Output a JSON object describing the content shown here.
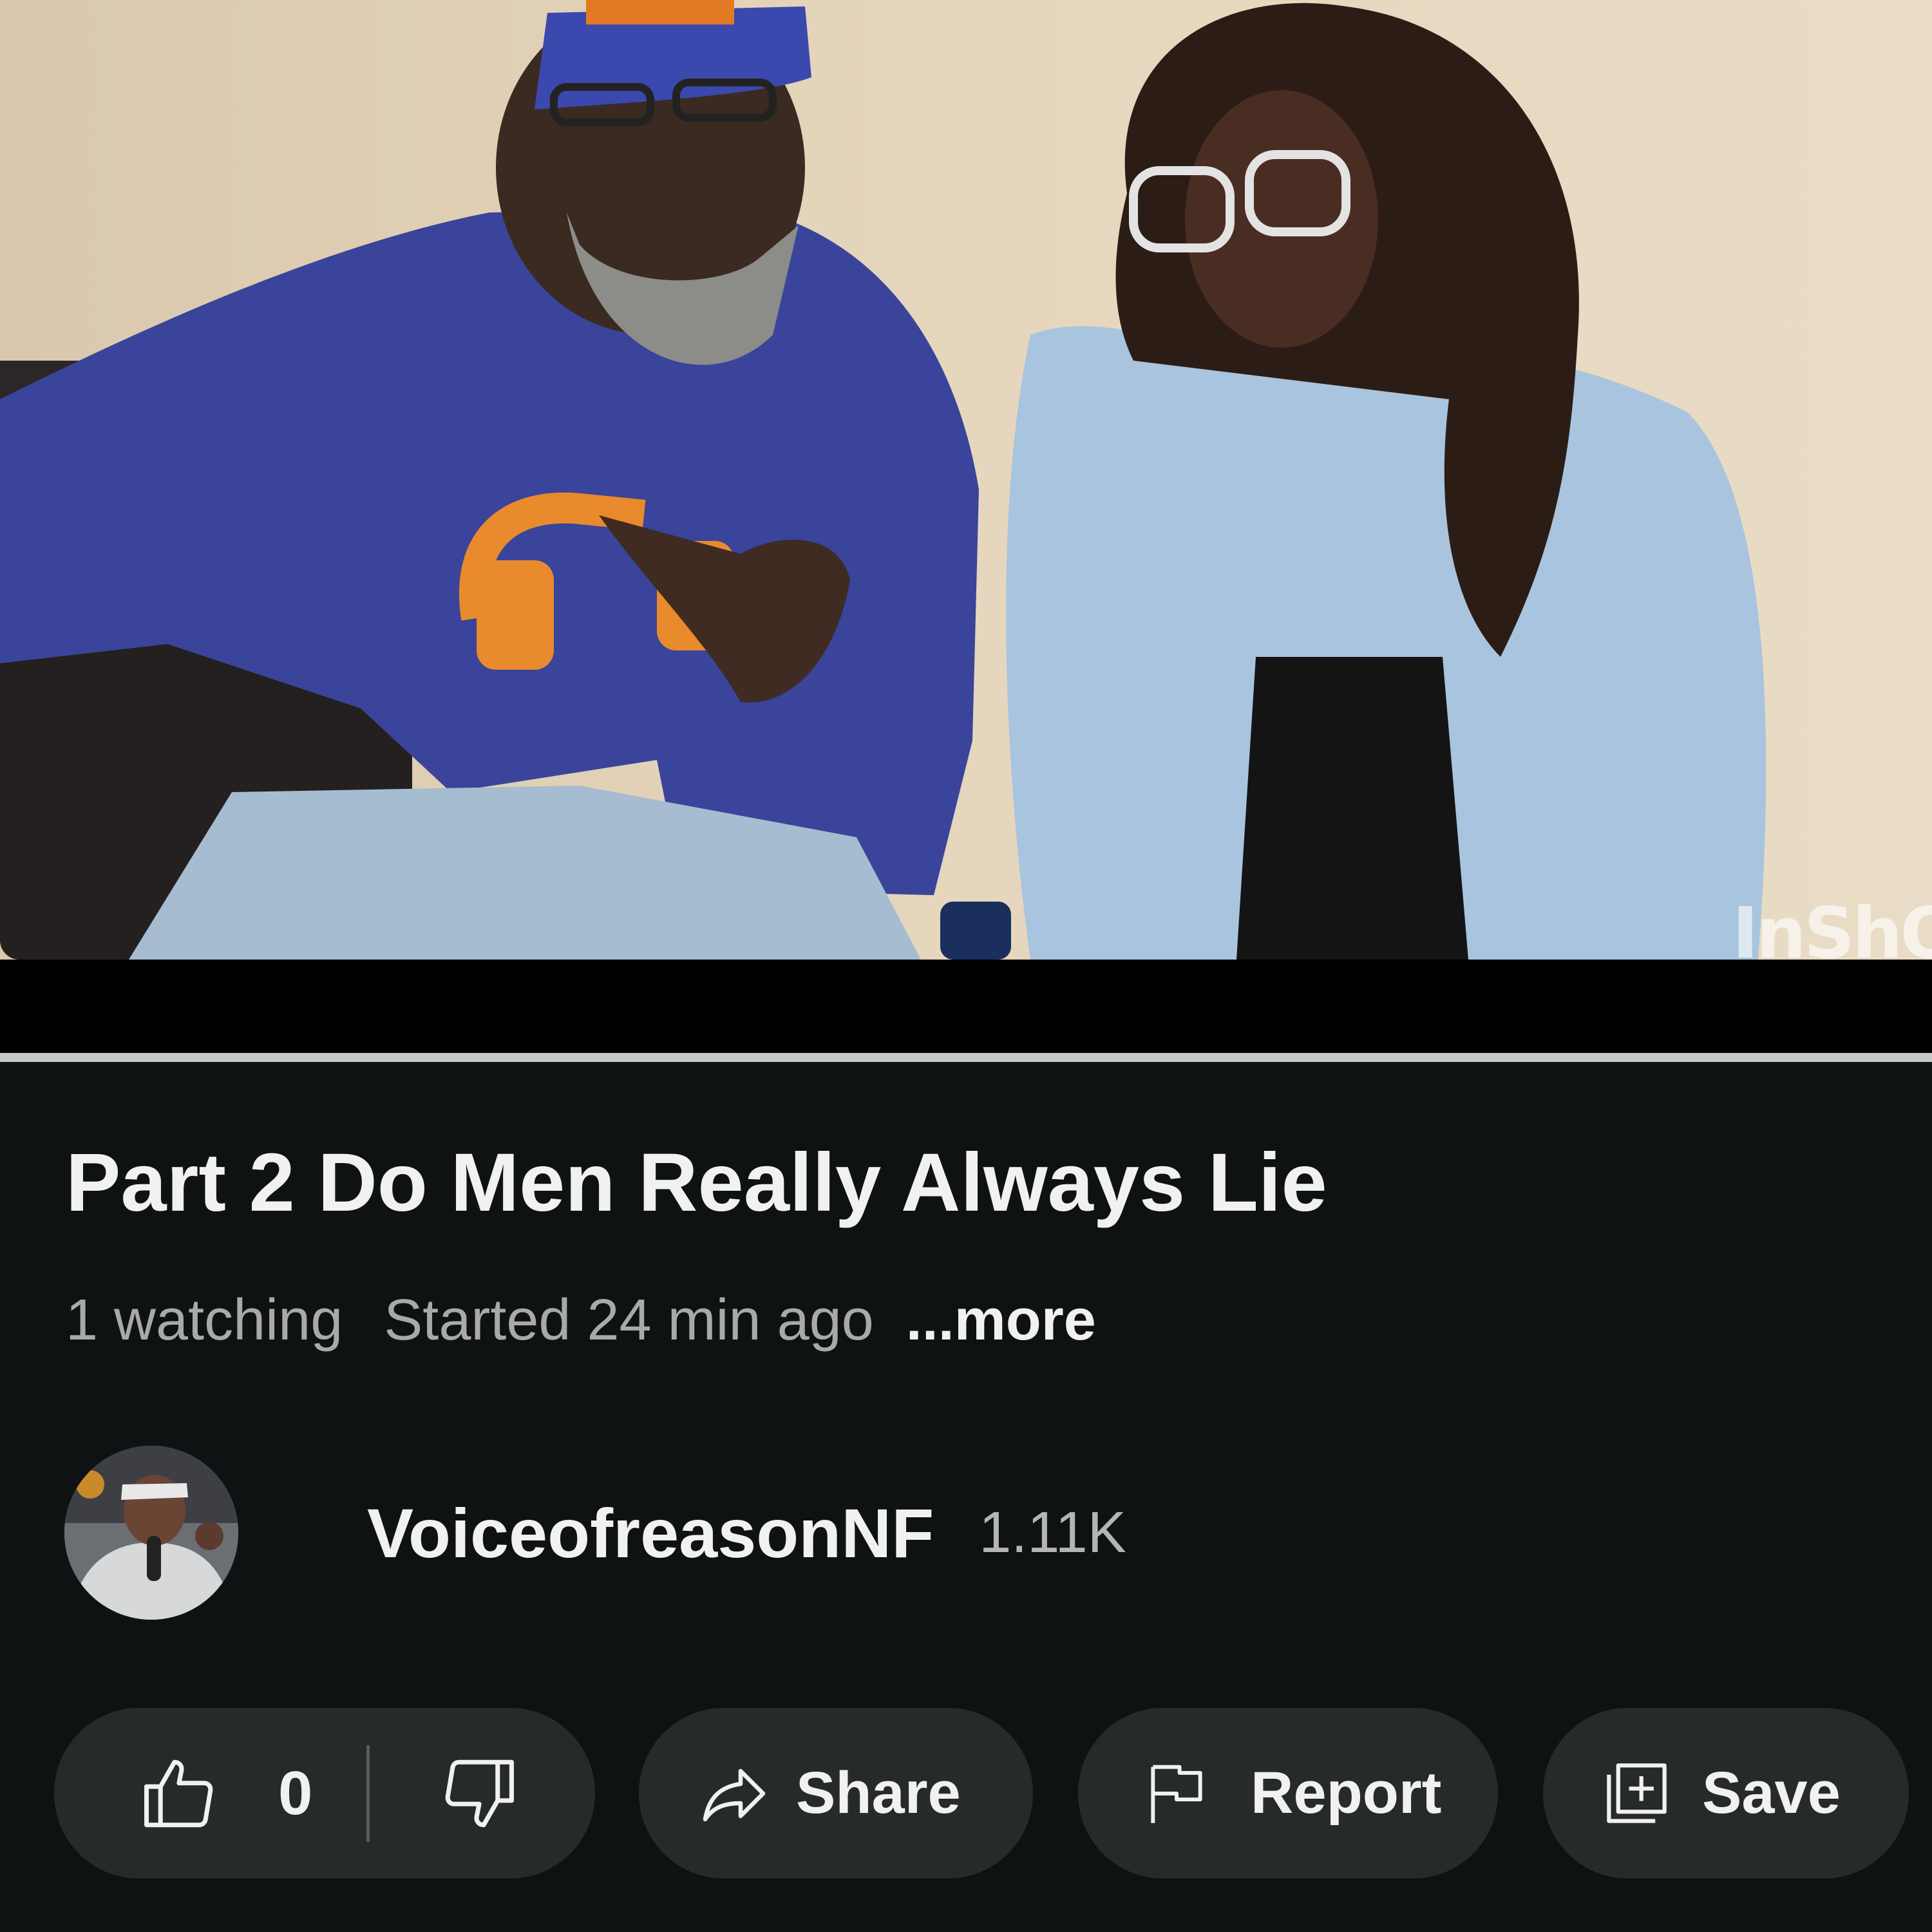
{
  "player": {
    "watermark": "InShO"
  },
  "video": {
    "title": "Part 2 Do Men Really Always Lie",
    "watching": "1 watching",
    "started": "Started 24 min ago",
    "more_label": "...more"
  },
  "channel": {
    "name": "VoiceofreasonNF",
    "subscribers": "1.11K"
  },
  "actions": {
    "like_count": "0",
    "share_label": "Share",
    "report_label": "Report",
    "save_label": "Save"
  },
  "colors": {
    "background": "#0f1213",
    "pill": "#272a2b",
    "text_primary": "#f1f1f1",
    "text_secondary": "#a9a9a9",
    "progress_bar": "#c7c7c7"
  },
  "icons": {
    "like": "thumbs-up-icon",
    "dislike": "thumbs-down-icon",
    "share": "share-arrow-icon",
    "report": "flag-icon",
    "save": "add-to-playlist-icon"
  }
}
